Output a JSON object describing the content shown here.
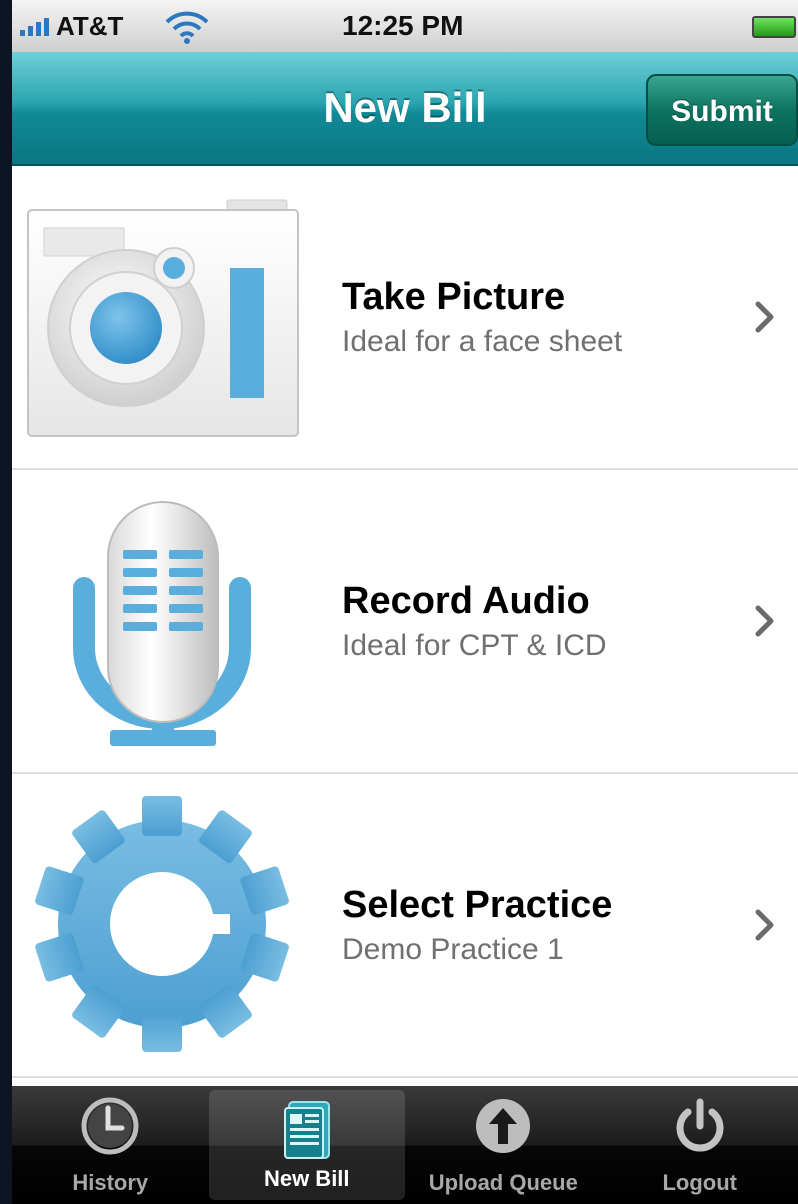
{
  "status_bar": {
    "carrier": "AT&T",
    "time": "12:25 PM"
  },
  "nav_bar": {
    "title": "New Bill",
    "submit_label": "Submit"
  },
  "menu": {
    "items": [
      {
        "label": "Take Picture",
        "sublabel": "Ideal for a face sheet",
        "icon": "camera-icon"
      },
      {
        "label": "Record Audio",
        "sublabel": "Ideal for CPT & ICD",
        "icon": "microphone-icon"
      },
      {
        "label": "Select Practice",
        "sublabel": "Demo Practice 1",
        "icon": "gear-icon"
      }
    ]
  },
  "tab_bar": {
    "tabs": [
      {
        "label": "History",
        "icon": "clock-icon"
      },
      {
        "label": "New Bill",
        "icon": "document-icon",
        "selected": true
      },
      {
        "label": "Upload Queue",
        "icon": "upload-arrow-icon"
      },
      {
        "label": "Logout",
        "icon": "power-icon"
      }
    ]
  },
  "colors": {
    "nav_teal": "#108a96",
    "submit_green": "#0d7360",
    "icon_blue": "#5aaedb"
  }
}
